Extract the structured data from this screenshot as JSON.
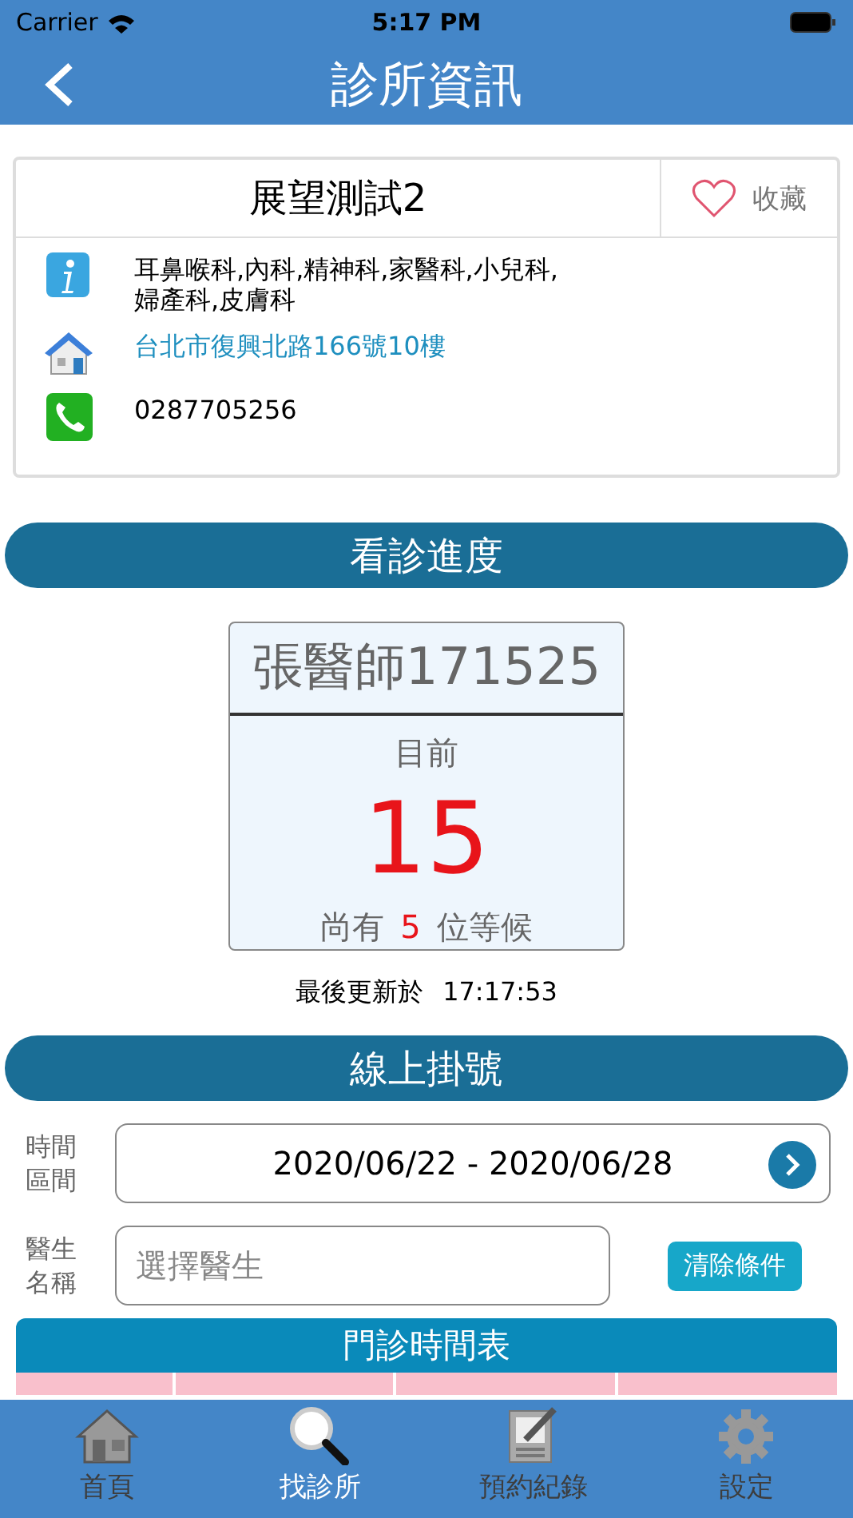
{
  "status_bar": {
    "carrier": "Carrier",
    "time": "5:17 PM"
  },
  "nav": {
    "title": "診所資訊"
  },
  "clinic": {
    "name": "展望測試2",
    "favorite": {
      "label": "收藏",
      "on": false
    },
    "departments": "耳鼻喉科,內科,精神科,家醫科,小兒科,婦產科,皮膚科",
    "address": "台北市復興北路166號10樓",
    "phone": "0287705256"
  },
  "progress": {
    "title": "看診進度",
    "doctor": "張醫師171525",
    "current_label": "目前",
    "current_number": "15",
    "waiting_prefix": "尚有",
    "waiting_count": "5",
    "waiting_suffix": "位等候",
    "updated_label": "最後更新於",
    "updated_time": "17:17:53"
  },
  "registration": {
    "title": "線上掛號",
    "period_label": "時間區間",
    "period_value": "2020/06/22 - 2020/06/28",
    "doctor_label": "醫生名稱",
    "doctor_placeholder": "選擇醫生",
    "clear_button": "清除條件",
    "timetable_title": "門診時間表"
  },
  "tabs": [
    {
      "label": "首頁",
      "kind": "home",
      "selected": false
    },
    {
      "label": "找診所",
      "kind": "search",
      "selected": true
    },
    {
      "label": "預約紀錄",
      "kind": "notes",
      "selected": false
    },
    {
      "label": "設定",
      "kind": "settings",
      "selected": false
    }
  ]
}
